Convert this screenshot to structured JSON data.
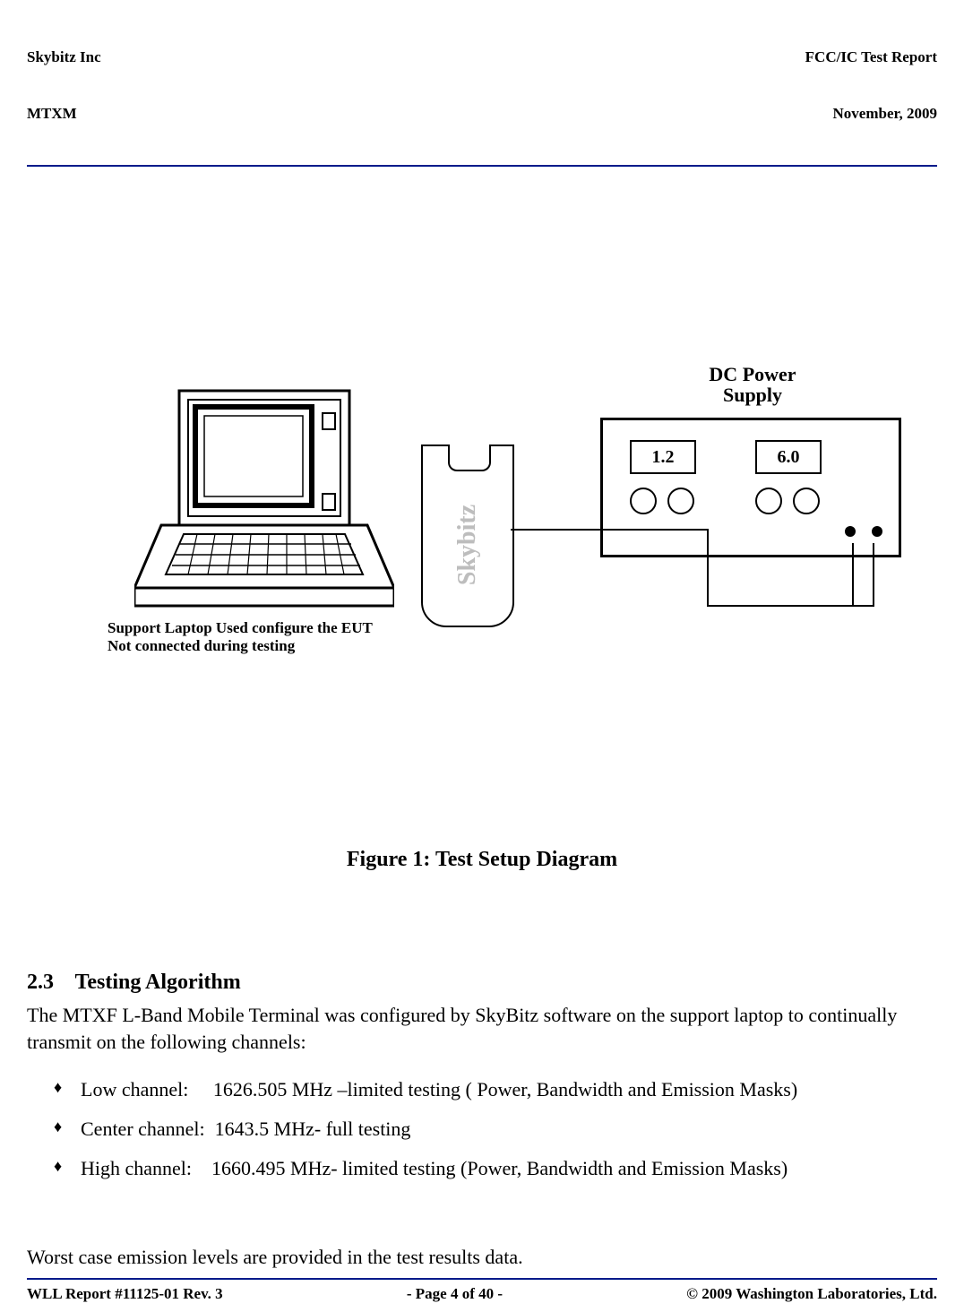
{
  "header": {
    "left_line1": "Skybitz Inc",
    "left_line2": "MTXM",
    "right_line1": "FCC/IC Test Report",
    "right_line2": "November, 2009"
  },
  "diagram": {
    "device_label": "Skybitz",
    "psu_caption_l1": "DC Power",
    "psu_caption_l2": "Supply",
    "psu_display1": "1.2",
    "psu_display2": "6.0",
    "laptop_caption_l1": "Support Laptop Used configure the EUT",
    "laptop_caption_l2": "Not connected during testing"
  },
  "figure_title": "Figure 1: Test Setup Diagram",
  "section": {
    "number": "2.3",
    "title": "Testing Algorithm"
  },
  "body": {
    "para1": "The MTXF L-Band Mobile Terminal was configured by SkyBitz software on the support laptop to continually transmit on the following channels:",
    "bullets": [
      "Low channel:     1626.505 MHz –limited testing ( Power, Bandwidth and Emission Masks)",
      "Center channel:  1643.5 MHz- full testing",
      "High channel:    1660.495 MHz- limited testing (Power, Bandwidth and Emission Masks)"
    ],
    "para2": "Worst case emission levels are provided in the test results data."
  },
  "footer": {
    "left": "WLL Report #11125-01 Rev. 3",
    "center": "- Page 4 of 40 -",
    "right": "© 2009 Washington Laboratories, Ltd."
  }
}
